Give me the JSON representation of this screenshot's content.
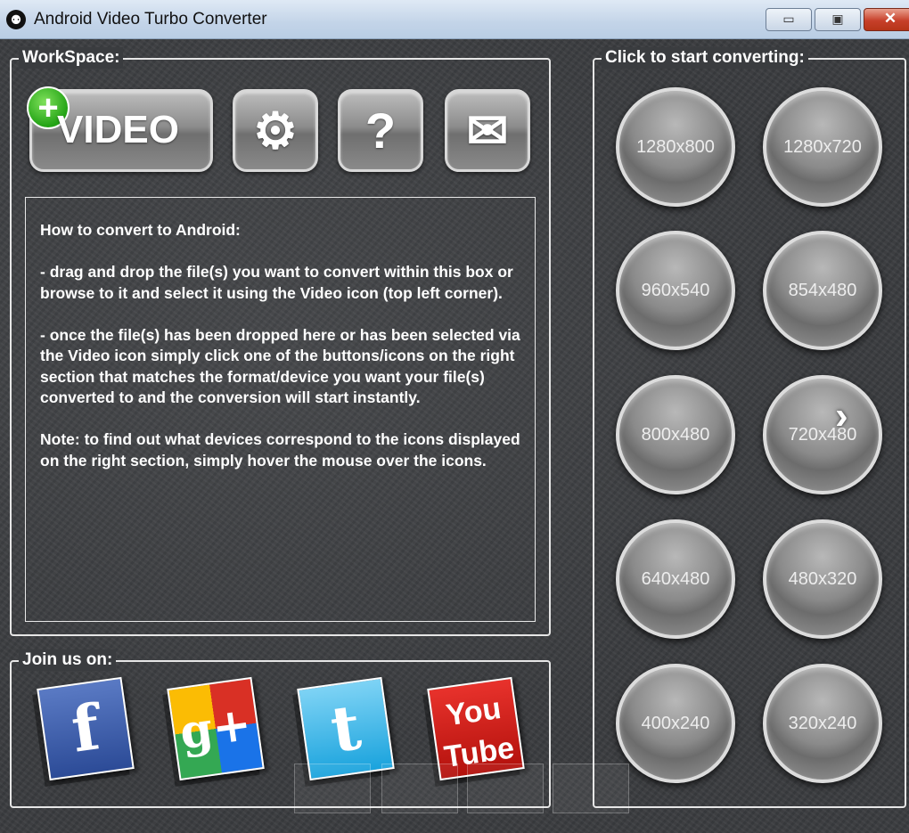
{
  "window": {
    "title": "Android Video Turbo Converter",
    "icon": "android-icon",
    "minimize_glyph": "▭",
    "maximize_glyph": "▣",
    "close_glyph": "✕"
  },
  "workspace": {
    "label": "WorkSpace:",
    "video_button": {
      "label": "VIDEO",
      "badge": "+"
    },
    "settings_glyph": "⚙",
    "help_glyph": "?",
    "mail_glyph": "✉",
    "instructions": {
      "heading": "How to convert to Android:",
      "p1": "- drag and drop the file(s) you want to convert within this box or browse to it and select it using the Video icon (top left corner).",
      "p2": "- once the file(s) has been dropped here or has been selected via the Video icon simply click one of the buttons/icons on the right section that matches the format/device you want your file(s) converted to and the conversion will start instantly.",
      "p3": "Note: to find out what devices correspond to the icons displayed on the right section, simply hover the mouse over the icons."
    }
  },
  "converting": {
    "label": "Click to start converting:",
    "resolutions": [
      "1280x800",
      "1280x720",
      "960x540",
      "854x480",
      "800x480",
      "720x480",
      "640x480",
      "480x320",
      "400x240",
      "320x240"
    ],
    "next_glyph": "›"
  },
  "join": {
    "label": "Join us on:",
    "facebook_glyph": "f",
    "googleplus_glyph": "g+",
    "twitter_glyph": "t",
    "youtube_you": "You",
    "youtube_tube": "Tube"
  }
}
